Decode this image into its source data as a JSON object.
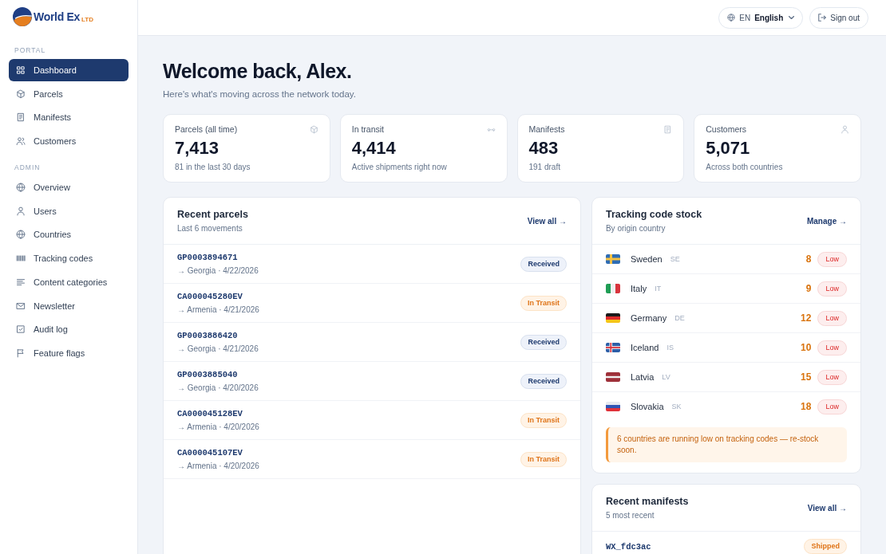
{
  "brand": {
    "name": "World Ex",
    "suffix": "LTD"
  },
  "sidebar": {
    "sections": [
      {
        "heading": "PORTAL",
        "items": [
          {
            "label": "Dashboard",
            "selected": true
          },
          {
            "label": "Parcels",
            "selected": false
          },
          {
            "label": "Manifests",
            "selected": false
          },
          {
            "label": "Customers",
            "selected": false
          }
        ]
      },
      {
        "heading": "ADMIN",
        "items": [
          {
            "label": "Overview",
            "selected": false
          },
          {
            "label": "Users",
            "selected": false
          },
          {
            "label": "Countries",
            "selected": false
          },
          {
            "label": "Tracking codes",
            "selected": false
          },
          {
            "label": "Content categories",
            "selected": false
          },
          {
            "label": "Newsletter",
            "selected": false
          },
          {
            "label": "Audit log",
            "selected": false
          },
          {
            "label": "Feature flags",
            "selected": false
          }
        ]
      }
    ]
  },
  "topbar": {
    "language": {
      "code": "EN",
      "name": "English"
    },
    "sign_out": "Sign out"
  },
  "header": {
    "title": "Welcome back, Alex.",
    "subtitle": "Here's what's moving across the network today."
  },
  "stats": [
    {
      "label": "Parcels (all time)",
      "value": "7,413",
      "note": "81 in the last 30 days"
    },
    {
      "label": "In transit",
      "value": "4,414",
      "note": "Active shipments right now"
    },
    {
      "label": "Manifests",
      "value": "483",
      "note": "191 draft"
    },
    {
      "label": "Customers",
      "value": "5,071",
      "note": "Across both countries"
    }
  ],
  "recent_parcels": {
    "title": "Recent parcels",
    "subtitle": "Last 6 movements",
    "link": "View all →",
    "rows": [
      {
        "code": "GP0003894671",
        "route": "→ Georgia · 4/22/2026",
        "status": "Received",
        "kind": "received"
      },
      {
        "code": "CA000045280EV",
        "route": "→ Armenia · 4/21/2026",
        "status": "In Transit",
        "kind": "in_transit"
      },
      {
        "code": "GP0003886420",
        "route": "→ Georgia · 4/21/2026",
        "status": "Received",
        "kind": "received"
      },
      {
        "code": "GP0003885040",
        "route": "→ Georgia · 4/20/2026",
        "status": "Received",
        "kind": "received"
      },
      {
        "code": "CA000045128EV",
        "route": "→ Armenia · 4/20/2026",
        "status": "In Transit",
        "kind": "in_transit"
      },
      {
        "code": "CA000045107EV",
        "route": "→ Armenia · 4/20/2026",
        "status": "In Transit",
        "kind": "in_transit"
      }
    ]
  },
  "tracking_stock": {
    "title": "Tracking code stock",
    "subtitle": "By origin country",
    "link": "Manage →",
    "rows": [
      {
        "country": "Sweden",
        "code": "SE",
        "count": "8",
        "status": "Low",
        "kind": "low"
      },
      {
        "country": "Italy",
        "code": "IT",
        "count": "9",
        "status": "Low",
        "kind": "low"
      },
      {
        "country": "Germany",
        "code": "DE",
        "count": "12",
        "status": "Low",
        "kind": "low"
      },
      {
        "country": "Iceland",
        "code": "IS",
        "count": "10",
        "status": "Low",
        "kind": "low"
      },
      {
        "country": "Latvia",
        "code": "LV",
        "count": "15",
        "status": "Low",
        "kind": "low"
      },
      {
        "country": "Slovakia",
        "code": "SK",
        "count": "18",
        "status": "Low",
        "kind": "low"
      }
    ],
    "alert": {
      "kind": "warning",
      "text": "6 countries are running low on tracking codes — re-stock soon."
    }
  },
  "recent_manifests": {
    "title": "Recent manifests",
    "subtitle": "5 most recent",
    "link": "View all →",
    "rows": [
      {
        "code": "WX_fdc3ac",
        "status": "Shipped",
        "kind": "shipped"
      }
    ]
  }
}
